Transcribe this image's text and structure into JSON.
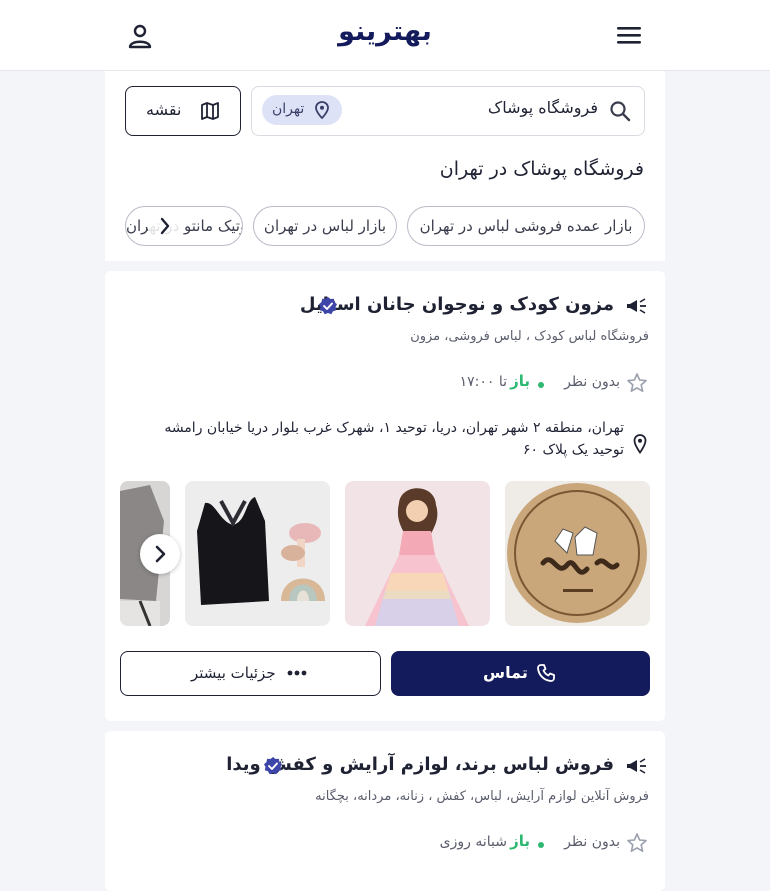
{
  "header": {
    "logo": "بهترینو"
  },
  "search": {
    "query": "فروشگاه پوشاک",
    "city": "تهران",
    "map_label": "نقشه"
  },
  "page": {
    "title": "فروشگاه پوشاک در تهران"
  },
  "chips": [
    "بازار عمده فروشی لباس در تهران",
    "بازار لباس در تهران",
    "بوتیک مانتو در تهران"
  ],
  "listings": [
    {
      "title": "مزون کودک و نوجوان جانان استایل",
      "categories": "فروشگاه لباس کودک ، لباس فروشی، مزون",
      "no_rating": "بدون نظر",
      "status": "باز",
      "hours": "تا ۱۷:۰۰",
      "address": "تهران، منطقه ۲ شهر تهران، دریا، توحید ۱، شهرک غرب بلوار دریا خیابان رامشه توحید یک پلاک ۶۰",
      "call_label": "تماس",
      "more_label": "جزئیات بیشتر"
    },
    {
      "title": "فروش لباس برند، لوازم آرایش و کفش ویدا",
      "categories": "فروش آنلاین لوازم آرایش، لباس، کفش ، زنانه، مردانه، بچگانه",
      "no_rating": "بدون نظر",
      "status": "باز",
      "hours": "شبانه روزی"
    }
  ],
  "colors": {
    "brand": "#141b5c",
    "open": "#2eb872",
    "chip_city": "#dde2f7"
  }
}
